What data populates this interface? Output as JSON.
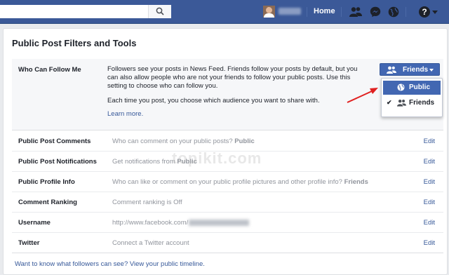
{
  "topbar": {
    "search_icon": "search-icon",
    "home_label": "Home",
    "icons": [
      "friend-requests-icon",
      "messages-icon",
      "notifications-globe-icon"
    ],
    "help_label": "?",
    "brand_color": "#3b5998"
  },
  "page": {
    "title": "Public Post Filters and Tools",
    "follow": {
      "label": "Who Can Follow Me",
      "description": "Followers see your posts in News Feed. Friends follow your posts by default, but you can also allow people who are not your friends to follow your public posts. Use this setting to choose who can follow you.",
      "description2": "Each time you post, you choose which audience you want to share with.",
      "learn_more": "Learn more.",
      "selector_value": "Friends",
      "menu": [
        {
          "label": "Public",
          "icon": "globe-icon",
          "selected": false,
          "highlighted": true
        },
        {
          "label": "Friends",
          "icon": "friends-icon",
          "selected": true,
          "highlighted": false
        }
      ]
    },
    "rows": [
      {
        "label": "Public Post Comments",
        "value": "Who can comment on your public posts?",
        "value_bold": "Public",
        "edit": "Edit"
      },
      {
        "label": "Public Post Notifications",
        "value": "Get notifications from",
        "value_bold": "Public",
        "edit": "Edit"
      },
      {
        "label": "Public Profile Info",
        "value": "Who can like or comment on your public profile pictures and other profile info?",
        "value_bold": "Friends",
        "edit": "Edit"
      },
      {
        "label": "Comment Ranking",
        "value": "Comment ranking is Off",
        "value_bold": "",
        "edit": "Edit"
      },
      {
        "label": "Username",
        "value": "http://www.facebook.com/",
        "value_bold": "",
        "edit": "Edit"
      },
      {
        "label": "Twitter",
        "value": "Connect a Twitter account",
        "value_bold": "",
        "edit": "Edit"
      }
    ],
    "footer_link": "Want to know what followers can see? View your public timeline.",
    "watermark": "topikit.com"
  }
}
